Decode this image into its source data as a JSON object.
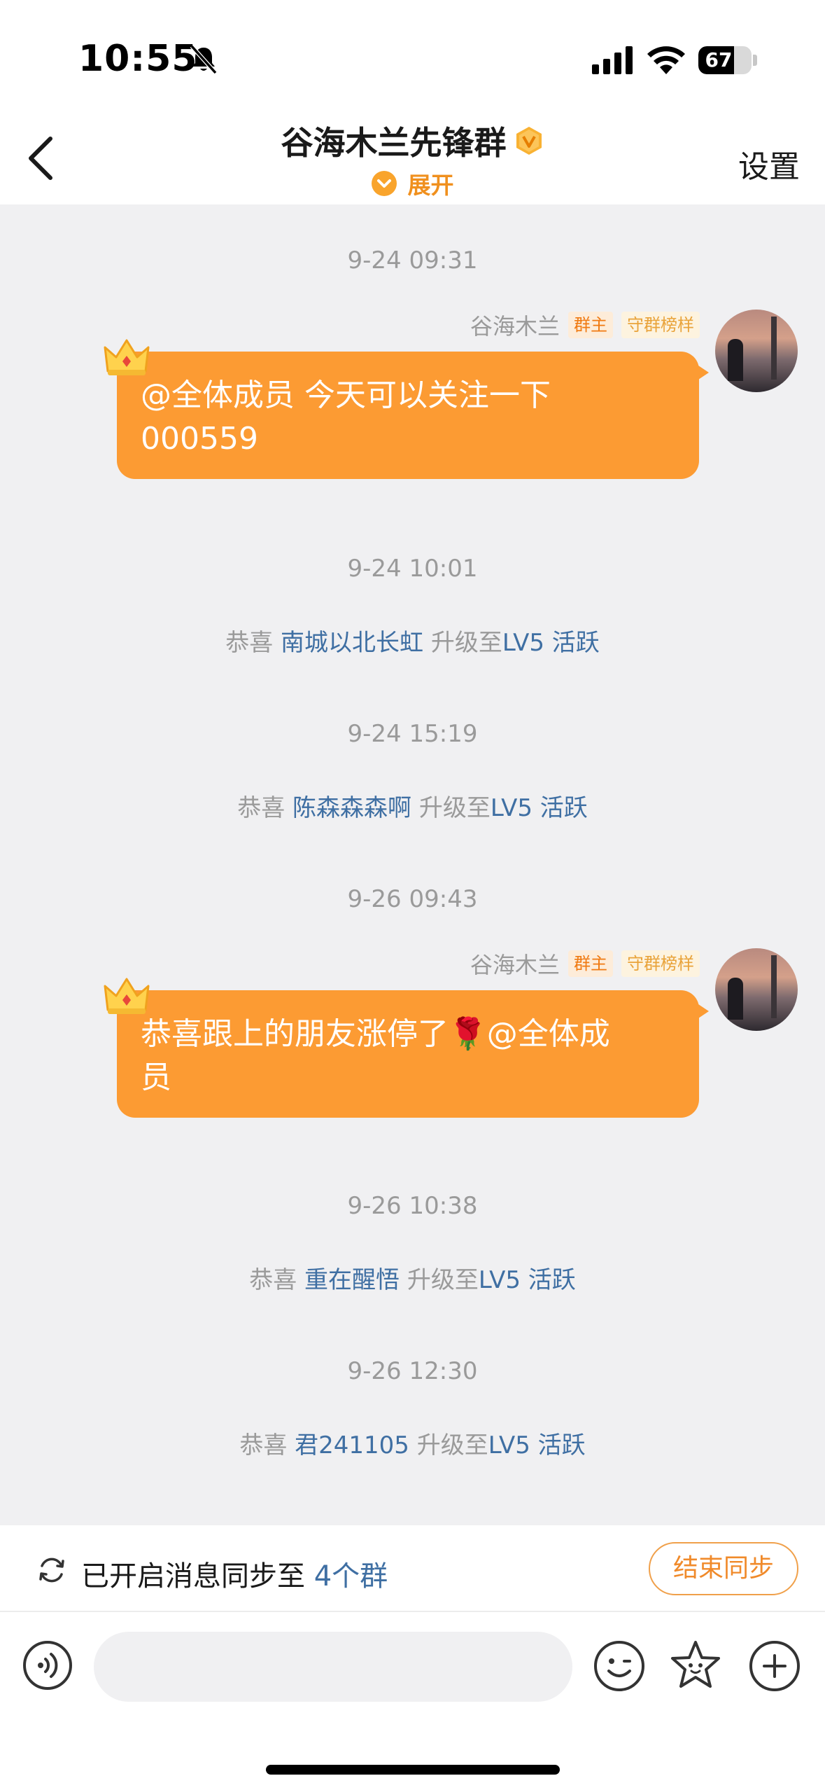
{
  "status_bar": {
    "time": "10:55",
    "battery_level": "67",
    "battery_fraction": 0.67
  },
  "header": {
    "title": "谷海木兰先锋群",
    "expand_label": "展开",
    "settings_label": "设置"
  },
  "messages": [
    {
      "timestamp": "9-24 09:31",
      "sender": "谷海木兰",
      "tag_owner": "群主",
      "tag_guard": "守群榜样",
      "text_line1": "@全体成员 今天可以关注一下",
      "text_line2": "000559"
    },
    {
      "timestamp": "9-26 09:43",
      "sender": "谷海木兰",
      "tag_owner": "群主",
      "tag_guard": "守群榜样",
      "text_line1": "恭喜跟上的朋友涨停了🌹@全体成",
      "text_line2": "员"
    }
  ],
  "notices": [
    {
      "timestamp": "9-24 10:01",
      "prefix": "恭喜",
      "name": "南城以北长虹",
      "action": "升级至",
      "level": "LV5 活跃"
    },
    {
      "timestamp": "9-24 15:19",
      "prefix": "恭喜",
      "name": "陈森森森啊",
      "action": "升级至",
      "level": "LV5 活跃"
    },
    {
      "timestamp": "9-26 10:38",
      "prefix": "恭喜",
      "name": "重在醒悟",
      "action": "升级至",
      "level": "LV5 活跃"
    },
    {
      "timestamp": "9-26 12:30",
      "prefix": "恭喜",
      "name": "君241105",
      "action": "升级至",
      "level": "LV5 活跃"
    }
  ],
  "sync_bar": {
    "text": "已开启消息同步至",
    "count": "4个群",
    "end_button": "结束同步"
  },
  "input_bar": {
    "placeholder": ""
  },
  "colors": {
    "accent_orange": "#fc9b33",
    "link_blue": "#3f6fa3",
    "chat_background": "#f0f0f2"
  },
  "icons": [
    "bell-slash-icon",
    "signal-icon",
    "wifi-icon",
    "battery-icon",
    "back-arrow-icon",
    "vip-badge-icon",
    "chevron-down-icon",
    "crown-icon",
    "sync-icon",
    "voice-icon",
    "emoji-icon",
    "star-icon",
    "plus-icon"
  ]
}
